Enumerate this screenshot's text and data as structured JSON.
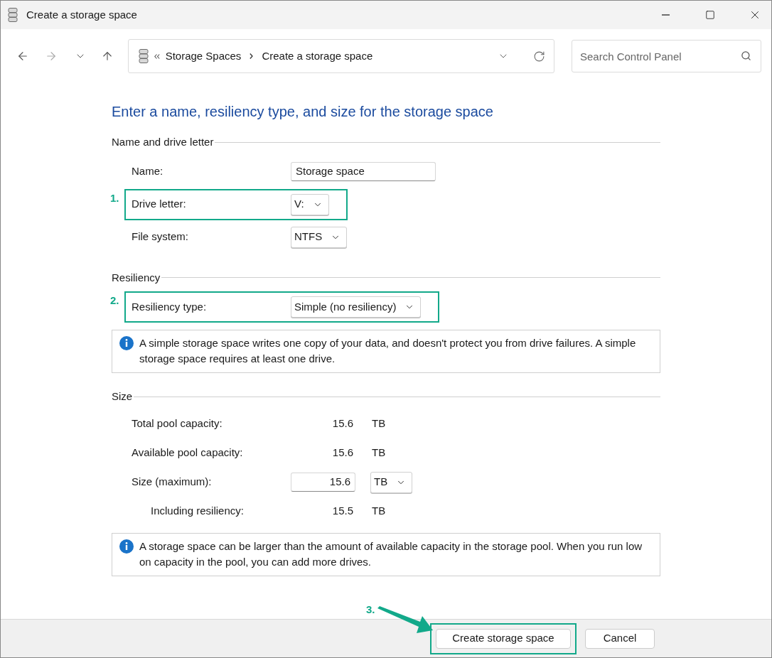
{
  "window": {
    "title": "Create a storage space"
  },
  "address_bar": {
    "crumbs": [
      {
        "label": "Storage Spaces"
      },
      {
        "label": "Create a storage space"
      }
    ]
  },
  "search": {
    "placeholder": "Search Control Panel"
  },
  "heading": "Enter a name, resiliency type, and size for the storage space",
  "sections": [
    {
      "title": "Name and drive letter",
      "rows": [
        {
          "kind": "text",
          "label": "Name:",
          "value": "Storage space"
        },
        {
          "kind": "dropdown",
          "label": "Drive letter:",
          "value": "V:",
          "annotation": "1."
        },
        {
          "kind": "dropdown",
          "label": "File system:",
          "value": "NTFS"
        }
      ]
    },
    {
      "title": "Resiliency",
      "rows": [
        {
          "kind": "dropdown",
          "label": "Resiliency type:",
          "value": "Simple (no resiliency)",
          "annotation": "2."
        }
      ],
      "info": "A simple storage space writes one copy of your data, and doesn't protect you from drive failures. A simple storage space requires at least one drive."
    },
    {
      "title": "Size",
      "rows": [
        {
          "kind": "reading",
          "label": "Total pool capacity:",
          "value": "15.6",
          "unit": "TB"
        },
        {
          "kind": "reading",
          "label": "Available pool capacity:",
          "value": "15.6",
          "unit": "TB"
        },
        {
          "kind": "size",
          "label": "Size (maximum):",
          "value": "15.6",
          "unit": "TB"
        },
        {
          "kind": "sub-reading",
          "label": "Including resiliency:",
          "value": "15.5",
          "unit": "TB"
        }
      ],
      "info": "A storage space can be larger than the amount of available capacity in the storage pool. When you run low on capacity in the pool, you can add more drives."
    }
  ],
  "buttons": [
    {
      "label": "Create storage space",
      "annotation": "3."
    },
    {
      "label": "Cancel"
    }
  ]
}
